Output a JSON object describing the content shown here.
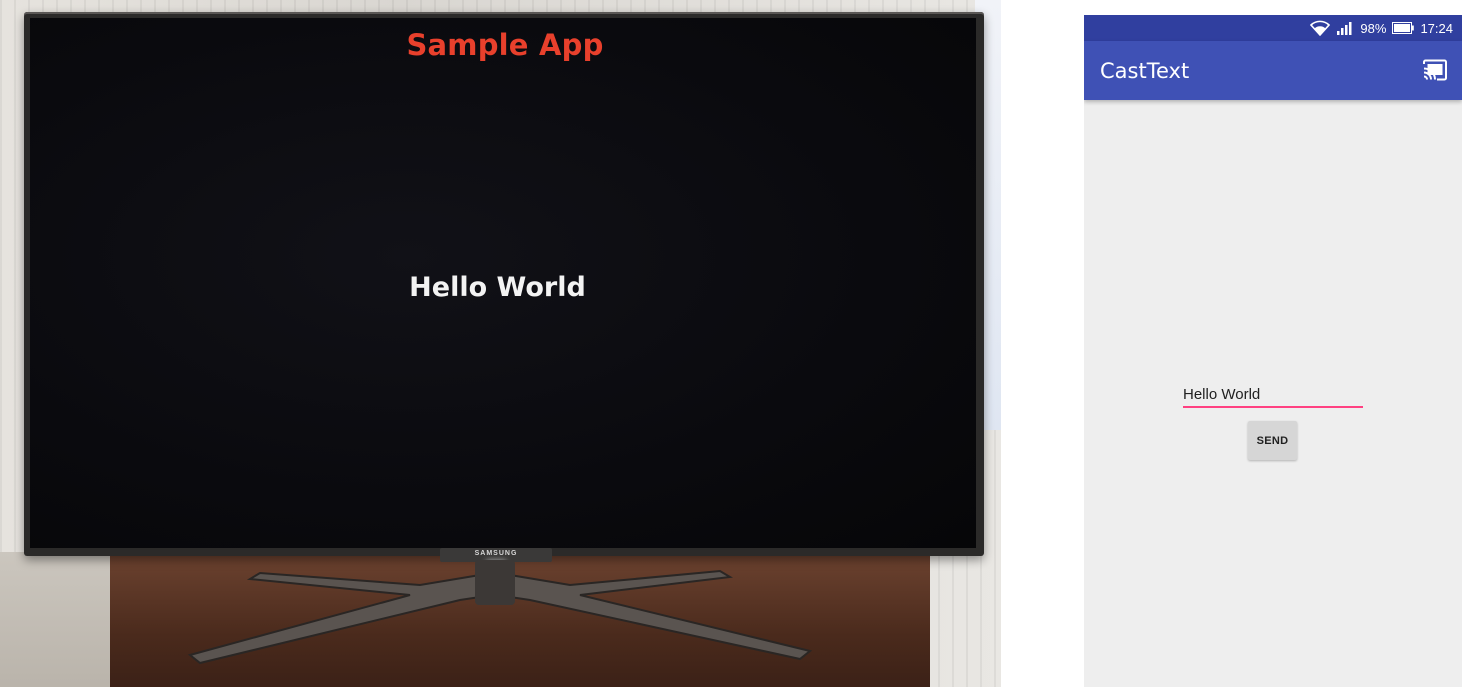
{
  "tv": {
    "app_title": "Sample App",
    "displayed_text": "Hello World",
    "brand": "SAMSUNG"
  },
  "phone": {
    "status_bar": {
      "battery": "98%",
      "time": "17:24",
      "icons": [
        "wifi-icon",
        "signal-icon",
        "battery-icon"
      ]
    },
    "app_bar": {
      "title": "CastText",
      "cast_icon": "cast-connected-icon"
    },
    "main": {
      "text_input_value": "Hello World",
      "send_label": "SEND"
    },
    "colors": {
      "primary": "#3f51b5",
      "primary_dark": "#303f9f",
      "accent": "#ff4081",
      "background": "#eeeeee"
    }
  }
}
